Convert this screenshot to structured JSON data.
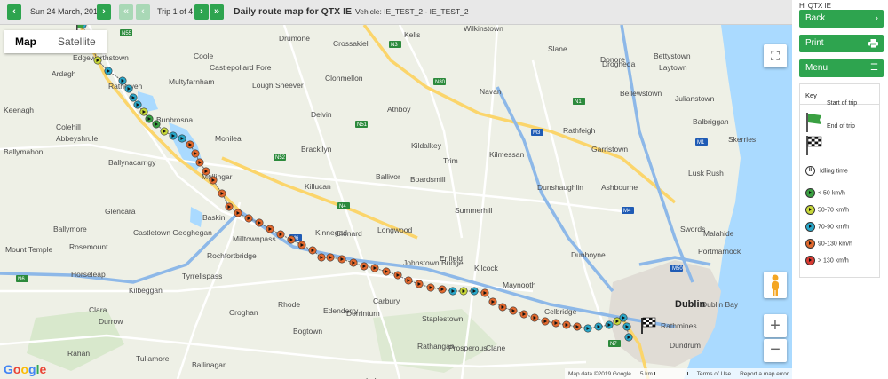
{
  "toolbar": {
    "prev_day": "‹",
    "date": "Sun 24 March, 2019",
    "next_day": "›",
    "first_trip": "«",
    "prev_trip": "‹",
    "trip_label": "Trip 1 of 4",
    "next_trip": "›",
    "last_trip": "»",
    "title": "Daily route map for QTX IE",
    "vehicle": "Vehicle: IE_TEST_2 - IE_TEST_2"
  },
  "map": {
    "type_map": "Map",
    "type_satellite": "Satellite",
    "fullscreen": "⛶",
    "zoom_in": "+",
    "zoom_out": "−",
    "google": "Google",
    "footer": {
      "data": "Map data ©2019 Google",
      "scale": "5 km",
      "terms": "Terms of Use",
      "report": "Report a map error"
    },
    "places": [
      "Kells",
      "Wilkinstown",
      "Drogheda",
      "Drumone",
      "Crossakiel",
      "Slane",
      "Donore",
      "Bettystown",
      "Laytown",
      "Coole",
      "Castlepollard Fore",
      "Lough Sheever",
      "Clonmellon",
      "Edgeworthstown",
      "Ardagh",
      "Multyfarnham",
      "Rathowen",
      "Bunbrosna",
      "Keenagh",
      "Colehill",
      "Abbeyshrule",
      "Ballymahon",
      "Ballynacarrigy",
      "Monilea",
      "Delvin",
      "Athboy",
      "Navan",
      "Bellewstown",
      "Julianstown",
      "Balbriggan",
      "Skerries",
      "Rush",
      "Lusk",
      "Kilmessan",
      "Trim",
      "Kildalkey",
      "Brackllyn",
      "Ballivor",
      "Killucan",
      "Mullingar",
      "Rathfeigh",
      "Garristown",
      "Dunshaughlin",
      "Ashbourne",
      "Boardsmill",
      "Summerhill",
      "Swords",
      "Malahide",
      "Portmarnock",
      "Glencara",
      "Ballymore",
      "Baskin",
      "Castletown Geoghegan",
      "Milltownpass",
      "Kinnegad",
      "Clonard",
      "Longwood",
      "Johnstown Bridge",
      "Enfield",
      "Kilcock",
      "Maynooth",
      "Celbridge",
      "Dunboyne",
      "Mount Temple",
      "Rosemount",
      "Horseleap",
      "Kilbeggan",
      "Tyrrellspass",
      "Rochfortbridge",
      "Clara",
      "Durrow",
      "Croghan",
      "Rhode",
      "Edenderry",
      "Derrinturn",
      "Carbury",
      "Staplestown",
      "Bogtown",
      "Prosperous",
      "Clane",
      "Rathangan",
      "Tullamore",
      "Ballinagar",
      "Lullymore",
      "Rahan",
      "Dublin",
      "Rathmines",
      "Dublin Bay",
      "Dundrum"
    ],
    "roads": [
      "N55",
      "N3",
      "N51",
      "N2",
      "N52",
      "M3",
      "M1",
      "N1",
      "M6",
      "N6",
      "M4",
      "M50",
      "N7",
      "N80",
      "N4"
    ]
  },
  "sidebar": {
    "greeting": "Hi QTX IE",
    "back_label": "Back",
    "back_icon": "chevron-right-icon",
    "print_label": "Print",
    "print_icon": "printer-icon",
    "menu_label": "Menu",
    "menu_icon": "hamburger-icon",
    "key": {
      "title": "Key",
      "items": [
        {
          "label": "Start of trip",
          "icon": "green-flag-icon"
        },
        {
          "label": "End of trip",
          "icon": "checkered-flag-icon"
        },
        {
          "label": "Idling time",
          "icon": "pause-icon"
        },
        {
          "label": "< 50 km/h",
          "color": "#3aa042"
        },
        {
          "label": "50-70 km/h",
          "color": "#c8d83a"
        },
        {
          "label": "70-90 km/h",
          "color": "#2aa7c9"
        },
        {
          "label": "90-130 km/h",
          "color": "#e2692e"
        },
        {
          "label": "> 130 km/h",
          "color": "#d93a32"
        }
      ]
    }
  },
  "colors": {
    "accent": "#2ea44f",
    "speed_lt50": "#3aa042",
    "speed_50_70": "#c8d83a",
    "speed_70_90": "#2aa7c9",
    "speed_90_130": "#e2692e",
    "speed_gt130": "#d93a32"
  }
}
